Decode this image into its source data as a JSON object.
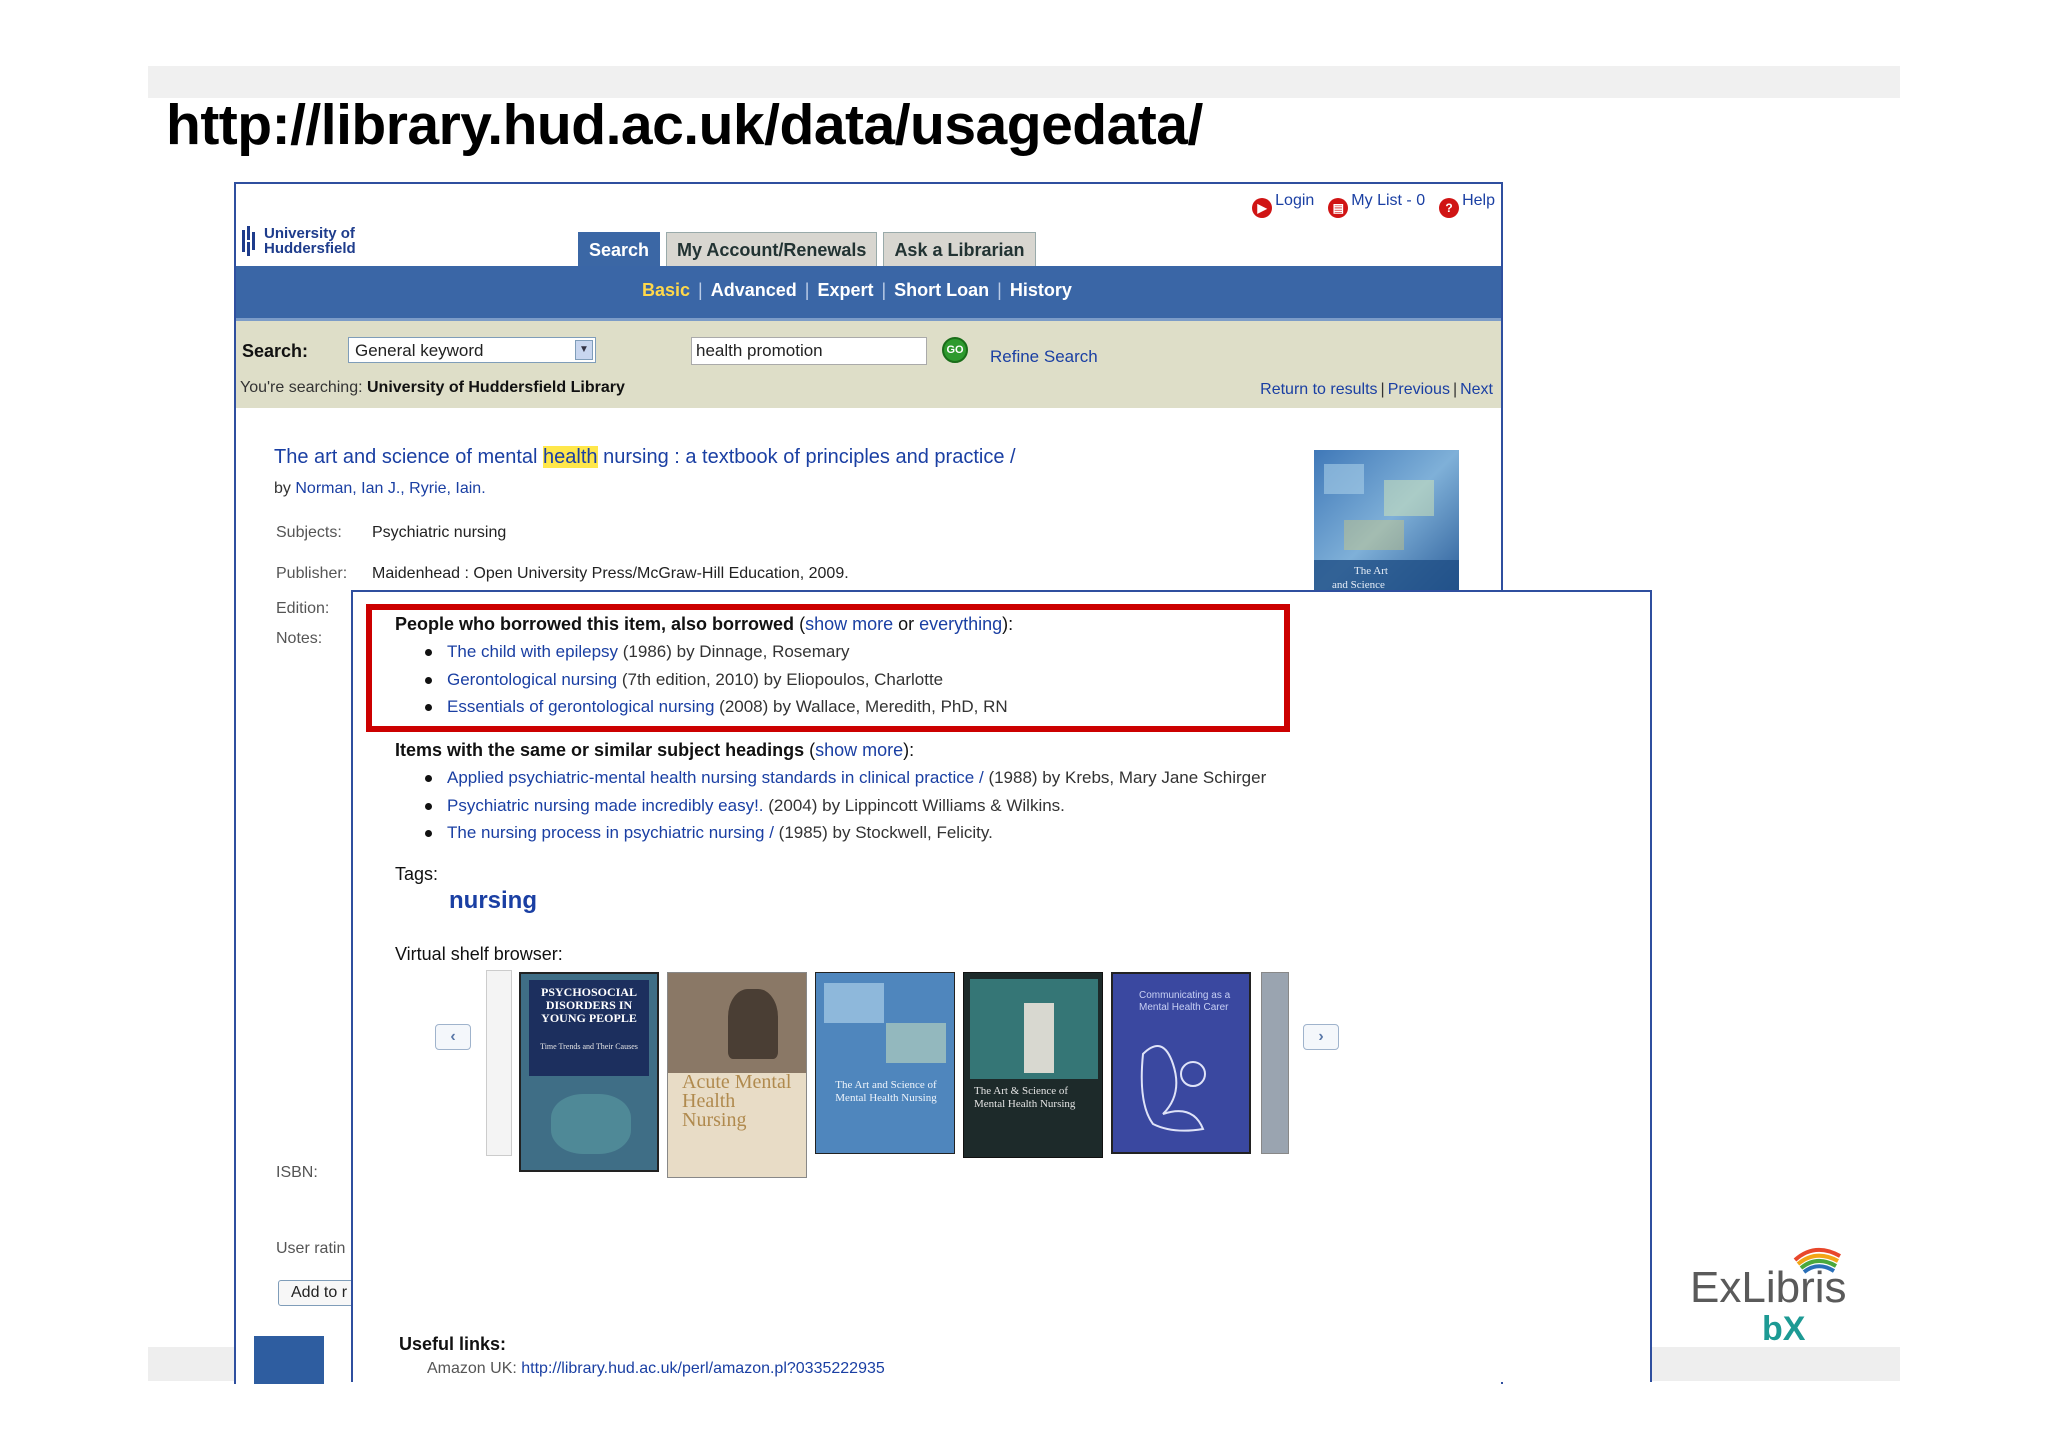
{
  "slide": {
    "title": "http://library.hud.ac.uk/data/usagedata/"
  },
  "catalogue": {
    "logo_line1": "University of",
    "logo_line2": "Huddersfield",
    "top_links": {
      "login": "Login",
      "my_list": "My List - 0",
      "help": "Help"
    },
    "tabs": [
      {
        "label": "Search"
      },
      {
        "label": "My Account/Renewals"
      },
      {
        "label": "Ask a Librarian"
      }
    ],
    "subnav": [
      "Basic",
      "Advanced",
      "Expert",
      "Short Loan",
      "History"
    ],
    "search": {
      "label": "Search:",
      "select_value": "General keyword",
      "query": "health promotion",
      "go": "GO",
      "refine": "Refine Search",
      "scope_prefix": "You're searching:",
      "scope_value": "University of Huddersfield Library",
      "nav": [
        "Return to results",
        "Previous",
        "Next"
      ]
    },
    "record": {
      "title_before": "The art and science of mental ",
      "title_highlight": "health",
      "title_after": " nursing : a textbook of principles and practice /",
      "by_prefix": "by",
      "authors": "Norman, Ian J., Ryrie, Iain.",
      "subjects_label": "Subjects:",
      "subjects_value": "Psychiatric nursing",
      "publisher_label": "Publisher:",
      "publisher_value": "Maidenhead : Open University Press/McGraw-Hill Education, 2009.",
      "edition_label": "Edition:",
      "notes_label": "Notes:",
      "isbn_label": "ISBN:",
      "user_rating_label": "User ratin",
      "add_button": "Add to r"
    }
  },
  "popup": {
    "also_borrowed": {
      "heading": "People who borrowed this item, also borrowed",
      "open_paren": " (",
      "show_more": "show more",
      "or": " or ",
      "everything": "everything",
      "close_paren": "):",
      "items": [
        {
          "title": "The child with epilepsy",
          "rest": " (1986) by Dinnage, Rosemary"
        },
        {
          "title": "Gerontological nursing",
          "rest": " (7th edition, 2010) by Eliopoulos, Charlotte"
        },
        {
          "title": "Essentials of gerontological nursing",
          "rest": " (2008) by Wallace, Meredith, PhD, RN"
        }
      ]
    },
    "similar": {
      "heading": "Items with the same or similar subject headings",
      "open_paren": " (",
      "show_more": "show more",
      "close_paren": "):",
      "items": [
        {
          "title": "Applied psychiatric-mental health nursing standards in clinical practice /",
          "rest": " (1988) by Krebs, Mary Jane Schirger"
        },
        {
          "title": "Psychiatric nursing made incredibly easy!.",
          "rest": " (2004) by Lippincott Williams & Wilkins."
        },
        {
          "title": "The nursing process in psychiatric nursing /",
          "rest": " (1985) by Stockwell, Felicity."
        }
      ]
    },
    "tags_label": "Tags:",
    "tag": "nursing",
    "shelf_label": "Virtual shelf browser:",
    "shelf_books": [
      {
        "title": "PSYCHOSOCIAL DISORDERS IN YOUNG PEOPLE",
        "subtitle": "Time Trends and Their Causes"
      },
      {
        "title": "Acute Mental Health Nursing"
      },
      {
        "title": "The Art and Science of Mental Health Nursing"
      },
      {
        "title": "The Art & Science of Mental Health Nursing"
      },
      {
        "title": "Communicating as a Mental Health Carer"
      }
    ],
    "useful_links_label": "Useful links:",
    "amazon_label": "Amazon UK:",
    "amazon_url": "http://library.hud.ac.uk/perl/amazon.pl?0335222935"
  },
  "brand": {
    "logo": "ExLibris",
    "product": "bX"
  },
  "colors": {
    "link": "#1a3fa3",
    "nav_blue": "#3a66a6",
    "highlight_box": "#cc0000",
    "search_bar": "#dedec8"
  }
}
